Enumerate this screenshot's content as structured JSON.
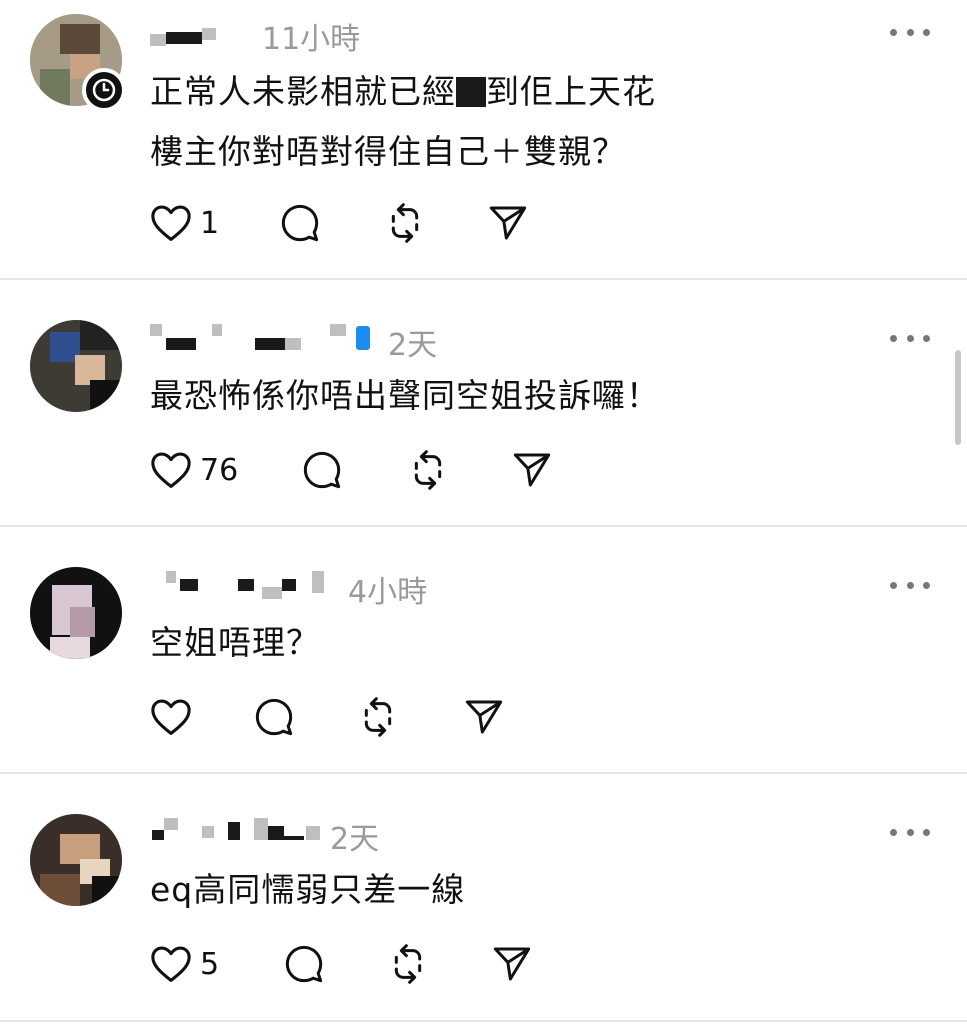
{
  "comments": [
    {
      "timestamp": "11小時",
      "line1_before": "正常人未影相就已經",
      "line1_after": "到佢上天花",
      "line2": "樓主你對唔對得住自己＋雙親？",
      "likes": "1",
      "has_clock_badge": true
    },
    {
      "timestamp": "2天",
      "text": "最恐怖係你唔出聲同空姐投訴囉！",
      "likes": "76",
      "verified": true
    },
    {
      "timestamp": "4小時",
      "text": "空姐唔理？",
      "likes": ""
    },
    {
      "timestamp": "2天",
      "text": "eq高同懦弱只差一線",
      "likes": "5"
    }
  ],
  "icons": {
    "like": "heart-icon",
    "reply": "comment-bubble-icon",
    "repost": "repost-icon",
    "share": "send-icon",
    "more": "more-dots-icon",
    "badge": "clock-icon"
  },
  "colors": {
    "text": "#111111",
    "muted": "#9a9a9a",
    "divider": "#e6e6e6",
    "verified": "#1d8cf0"
  }
}
